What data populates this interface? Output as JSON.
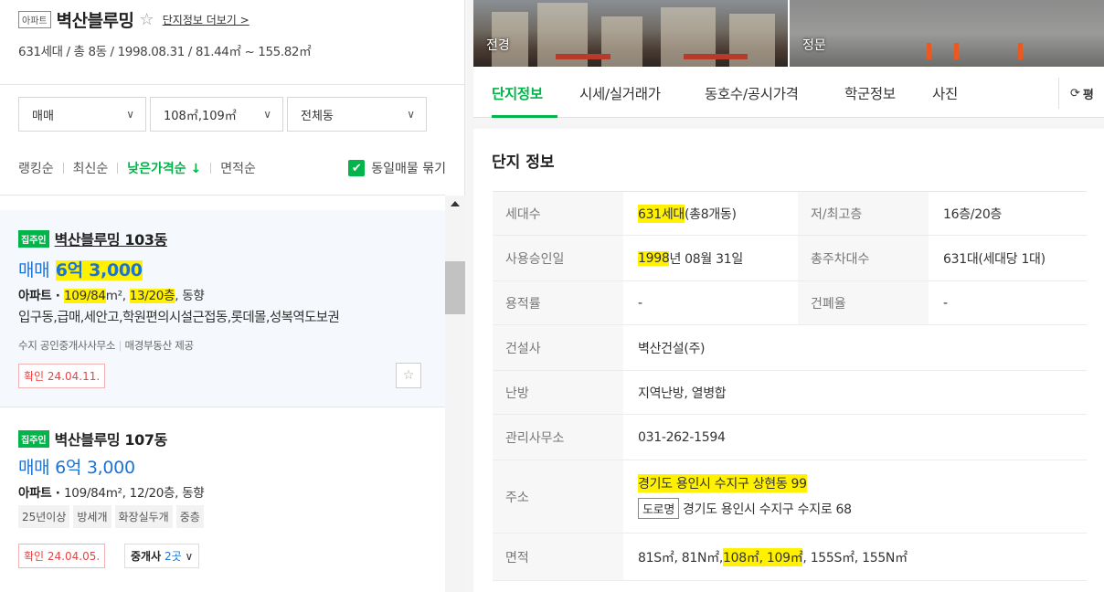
{
  "complex": {
    "type_tag": "아파트",
    "name": "벽산블루밍",
    "star": "☆",
    "more_link": "단지정보 더보기 >",
    "summary": "631세대 / 총 8동 / 1998.08.31 / 81.44㎡ ~ 155.82㎡"
  },
  "filters": [
    {
      "label": "매매",
      "icon": "chevron-down-icon"
    },
    {
      "label": "108㎡,109㎡",
      "icon": "chevron-down-icon"
    },
    {
      "label": "전체동",
      "icon": "chevron-down-icon"
    }
  ],
  "sort": {
    "ranking": "랭킹순",
    "latest": "최신순",
    "lowest_price": "낮은가격순 ↓",
    "area": "면적순",
    "group_same": "동일매물 묶기",
    "group_checked": true
  },
  "listings": [
    {
      "badge": "집주인",
      "title": "벽산블루밍 103동",
      "price_type": "매매",
      "price": "6억 3,000",
      "kind": "아파트",
      "area": "109/84",
      "area_unit": "m",
      "floor": "13/20층",
      "direction": ", 동향",
      "desc": "입구동,급매,세안고,학원편의시설근접동,롯데몰,성복역도보권",
      "agency": "수지 공인중개사사무소",
      "provider": "매경부동산 제공",
      "confirm": "확인 24.04.11."
    },
    {
      "badge": "집주인",
      "title": "벽산블루밍 107동",
      "price_type": "매매",
      "price": "6억 3,000",
      "kind": "아파트",
      "spec_rest": "109/84m², 12/20층, 동향",
      "tags": [
        "25년이상",
        "방세개",
        "화장실두개",
        "중층"
      ],
      "confirm": "확인 24.04.05.",
      "agents_label": "중개사",
      "agents_count": "2곳"
    }
  ],
  "photos": [
    {
      "caption": "전경"
    },
    {
      "caption": "정문"
    }
  ],
  "tabs": [
    "단지정보",
    "시세/실거래가",
    "동호수/공시가격",
    "학군정보",
    "사진"
  ],
  "refresh_label": "평",
  "info": {
    "title": "단지 정보",
    "households_label": "세대수",
    "households_hl": "631세대",
    "households_rest": "(총8개동)",
    "floors_label": "저/최고층",
    "floors": "16층/20층",
    "approval_label": "사용승인일",
    "approval_year": "1998",
    "approval_rest": "년 08월 31일",
    "parking_label": "총주차대수",
    "parking": "631대(세대당 1대)",
    "far_label": "용적률",
    "far": "-",
    "bcr_label": "건폐율",
    "bcr": "-",
    "builder_label": "건설사",
    "builder": "벽산건설(주)",
    "heating_label": "난방",
    "heating": "지역난방, 열병합",
    "office_label": "관리사무소",
    "office": "031-262-1594",
    "address_label": "주소",
    "address": "경기도 용인시 수지구 상현동 99",
    "road_tag": "도로명",
    "road_address": "경기도 용인시 수지구 수지로 68",
    "area_label": "면적",
    "area_pre": "81S㎡, 81N㎡, ",
    "area_hl": "108㎡, 109㎡",
    "area_post": ", 155S㎡, 155N㎡"
  }
}
